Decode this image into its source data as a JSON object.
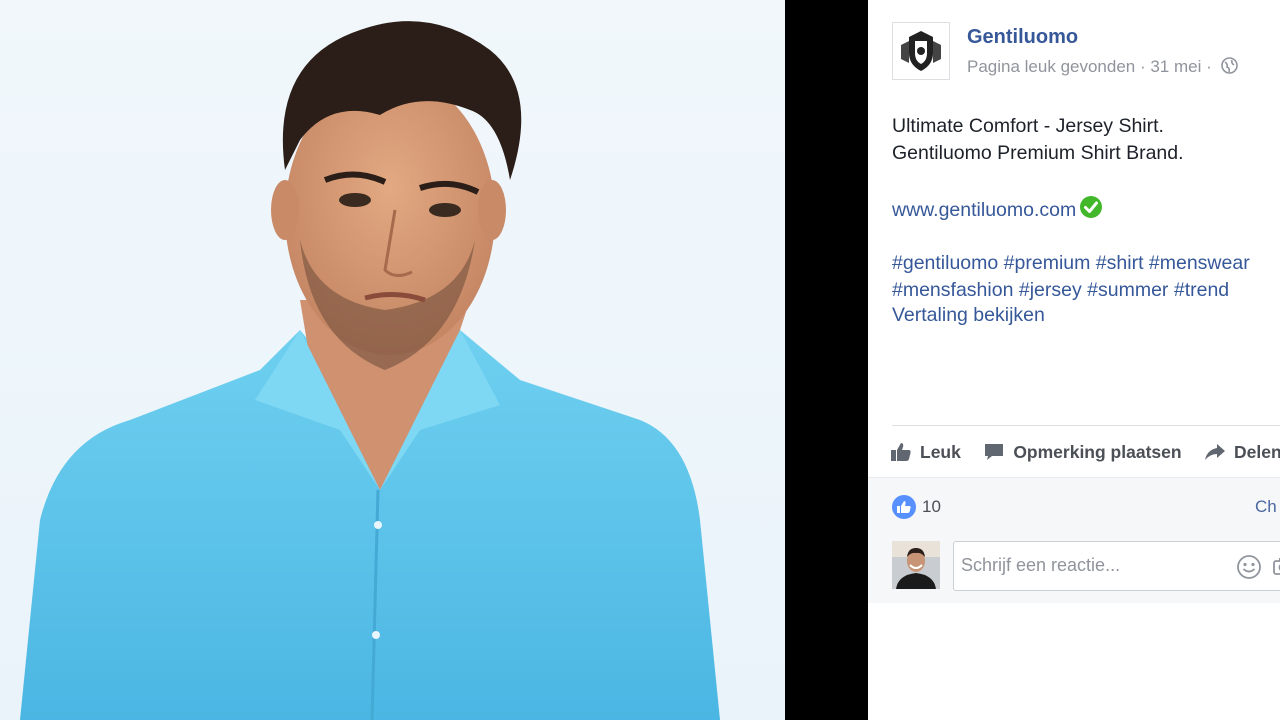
{
  "post": {
    "page_name": "Gentiluomo",
    "meta": "Pagina leuk gevonden · 31 mei ·",
    "text_line1": "Ultimate Comfort - Jersey Shirt.",
    "text_line2": "Gentiluomo Premium Shirt Brand.",
    "link": "www.gentiluomo.com",
    "hashtags_line1": [
      "#gentiluomo",
      "#premium",
      "#shirt",
      "#menswear"
    ],
    "hashtags_line2": [
      "#mensfashion",
      "#jersey",
      "#summer",
      "#trend"
    ],
    "translate": "Vertaling bekijken"
  },
  "actions": {
    "like": "Leuk",
    "comment": "Opmerking plaatsen",
    "share": "Delen"
  },
  "reactions": {
    "count": "10",
    "sort": "Ch"
  },
  "comment_composer": {
    "placeholder": "Schrijf een reactie..."
  },
  "colors": {
    "link": "#365899",
    "text": "#1d2129",
    "muted": "#90949c",
    "like_blue": "#5890ff",
    "check_green": "#42b72a",
    "shirt": "#5cc2e8"
  },
  "icons": [
    "globe-icon",
    "check-icon",
    "like-icon",
    "comment-icon",
    "share-icon",
    "emoji-icon",
    "camera-icon"
  ]
}
